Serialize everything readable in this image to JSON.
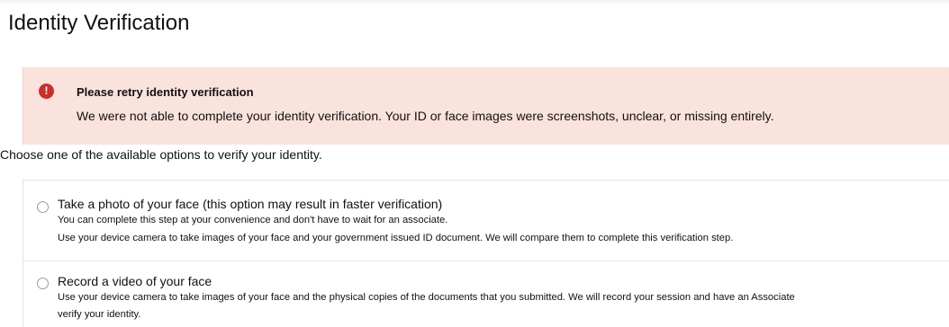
{
  "page": {
    "title": "Identity Verification"
  },
  "alert": {
    "icon": "exclamation-circle-icon",
    "icon_glyph": "!",
    "title": "Please retry identity verification",
    "message": "We were not able to complete your identity verification. Your ID or face images were screenshots, unclear, or missing entirely."
  },
  "instructions": "Choose one of the available options to verify your identity.",
  "options": [
    {
      "title": "Take a photo of your face (this option may result in faster verification)",
      "lines": [
        "You can complete this step at your convenience and don't have to wait for an associate.",
        "Use your device camera to take images of your face and your government issued ID document. We will compare them to complete this verification step."
      ],
      "selected": false
    },
    {
      "title": "Record a video of your face",
      "lines": [
        "Use your device camera to take images of your face and the physical copies of the documents that you submitted. We will record your session and have an Associate",
        "verify your identity."
      ],
      "selected": false
    }
  ],
  "colors": {
    "alert_background": "#fbe3dd",
    "alert_icon": "#c9302c",
    "border": "#e3e3e3"
  }
}
